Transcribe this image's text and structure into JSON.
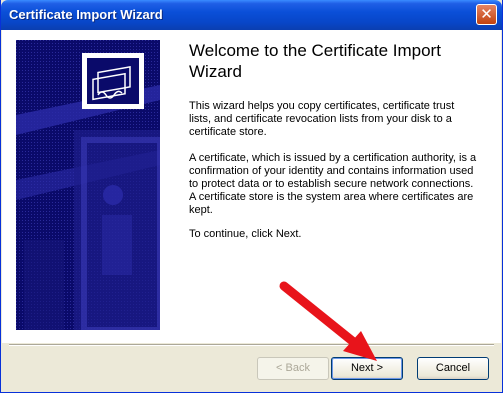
{
  "window": {
    "title": "Certificate Import Wizard",
    "close_glyph": "✕"
  },
  "main": {
    "heading": "Welcome to the Certificate Import Wizard",
    "paragraphs": [
      "This wizard helps you copy certificates, certificate trust lists, and certificate revocation lists from your disk to a certificate store.",
      "A certificate, which is issued by a certification authority, is a confirmation of your identity and contains information used to protect data or to establish secure network connections. A certificate store is the system area where certificates are kept.",
      "To continue, click Next."
    ]
  },
  "buttons": {
    "back": "< Back",
    "next": "Next >",
    "cancel": "Cancel"
  },
  "colors": {
    "titlebar": "#0a4fd8",
    "sidepanel": "#0a0a6a",
    "annotation_arrow": "#e8141b"
  },
  "icons": {
    "sidepanel_emblem": "certificate-icon",
    "annotation": "red-arrow-icon"
  }
}
